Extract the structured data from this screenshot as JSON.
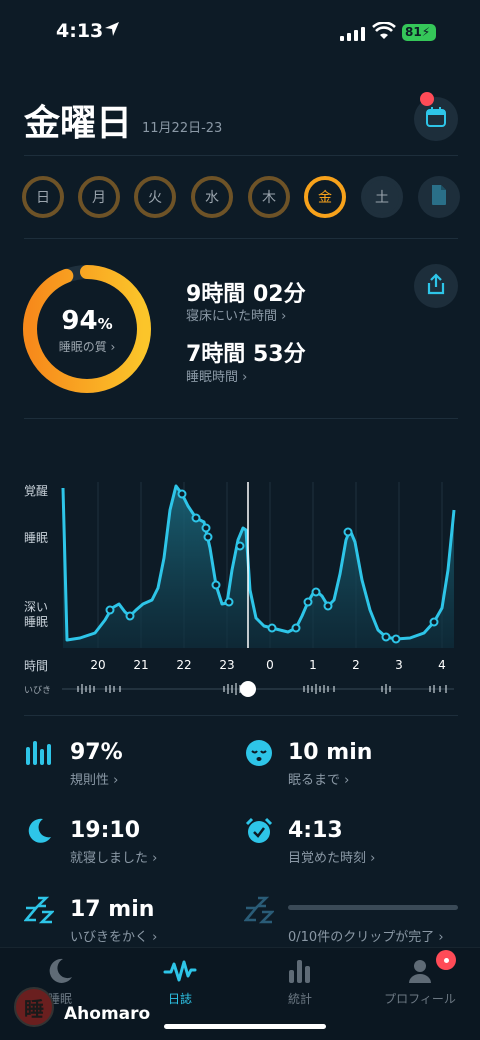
{
  "status_bar": {
    "time": "4:13",
    "battery": "81"
  },
  "header": {
    "day": "金曜日",
    "date_range": "11月22日-23"
  },
  "week": {
    "days": [
      "日",
      "月",
      "火",
      "水",
      "木",
      "金",
      "土"
    ],
    "active": "金"
  },
  "score": {
    "value": "94",
    "unit": "%",
    "label": "睡眠の質 ›",
    "fraction": 0.94
  },
  "stats": {
    "in_bed": {
      "value": "9時間 02分",
      "label": "寝床にいた時間 ›"
    },
    "asleep": {
      "value": "7時間 53分",
      "label": "睡眠時間 ›"
    }
  },
  "chart": {
    "y_labels": {
      "awake": "覚醒",
      "sleep": "睡眠",
      "deep1": "深い",
      "deep2": "睡眠",
      "time": "時間"
    },
    "snore_label": "いびき",
    "x_ticks": [
      "20",
      "21",
      "22",
      "23",
      "0",
      "1",
      "2",
      "3",
      "4"
    ]
  },
  "chart_data": {
    "type": "area",
    "y_categories": [
      "深い睡眠",
      "睡眠",
      "覚醒"
    ],
    "x_ticks": [
      "20",
      "21",
      "22",
      "23",
      "0",
      "1",
      "2",
      "3",
      "4"
    ]
  },
  "metrics": {
    "regularity": {
      "value": "97%",
      "label": "規則性 ›"
    },
    "to_sleep": {
      "value": "10 min",
      "label": "眠るまで ›"
    },
    "bedtime": {
      "value": "19:10",
      "label": "就寝しました ›"
    },
    "wake": {
      "value": "4:13",
      "label": "目覚めた時刻 ›"
    },
    "snore": {
      "value": "17 min",
      "label": "いびきをかく ›"
    },
    "clips": {
      "label": "0/10件のクリップが完了 ›"
    }
  },
  "tabs": [
    {
      "label": "睡眠"
    },
    {
      "label": "日誌"
    },
    {
      "label": "統計"
    },
    {
      "label": "プロフィール"
    }
  ],
  "watermark": {
    "name": "Ahomaro",
    "seal": "睡"
  },
  "colors": {
    "accent": "#2ec5e8",
    "score": "#f7a21b",
    "background": "#0d1b26"
  }
}
